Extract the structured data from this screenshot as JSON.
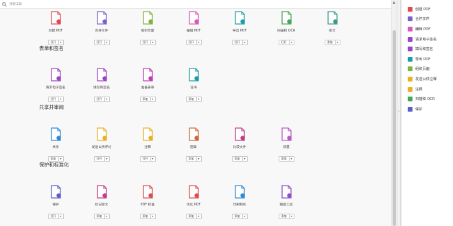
{
  "search": {
    "placeholder": "搜索工具"
  },
  "sections": [
    {
      "title": "",
      "tools": [
        {
          "name": "create-pdf",
          "label": "创建 PDF",
          "btn": "打开",
          "color": "#e34850"
        },
        {
          "name": "combine-files",
          "label": "合并文件",
          "btn": "打开",
          "color": "#7b61c7"
        },
        {
          "name": "organize-pages",
          "label": "组织页面",
          "btn": "打开",
          "color": "#7fb33b"
        },
        {
          "name": "edit-pdf",
          "label": "编辑 PDF",
          "btn": "打开",
          "color": "#d958b5"
        },
        {
          "name": "export-pdf",
          "label": "导出 PDF",
          "btn": "打开",
          "color": "#1b9fa3"
        },
        {
          "name": "scan-ocr",
          "label": "扫描和 OCR",
          "btn": "打开",
          "color": "#4aa35a"
        },
        {
          "name": "redact",
          "label": "密文",
          "btn": "添加",
          "color": "#3a9b8a"
        }
      ]
    },
    {
      "title": "表单和签名",
      "tools": [
        {
          "name": "request-signature",
          "label": "请求电子签名",
          "btn": "打开",
          "color": "#9c44c3"
        },
        {
          "name": "fill-sign",
          "label": "填写和签名",
          "btn": "打开",
          "color": "#9c44c3"
        },
        {
          "name": "prepare-form",
          "label": "准备表单",
          "btn": "添加",
          "color": "#c03dba"
        },
        {
          "name": "certificates",
          "label": "证书",
          "btn": "添加",
          "color": "#1b9fa3"
        }
      ]
    },
    {
      "title": "共享并审阅",
      "tools": [
        {
          "name": "share",
          "label": "共享",
          "btn": "添加",
          "color": "#2d89d6"
        },
        {
          "name": "send-for-comments",
          "label": "发送以供评论",
          "btn": "打开",
          "color": "#e8b023"
        },
        {
          "name": "comment",
          "label": "注释",
          "btn": "打开",
          "color": "#e8b023"
        },
        {
          "name": "stamp",
          "label": "图章",
          "btn": "添加",
          "color": "#c96b3b"
        },
        {
          "name": "compare-files",
          "label": "比较文件",
          "btn": "添加",
          "color": "#c03d85"
        },
        {
          "name": "measure",
          "label": "测量",
          "btn": "添加",
          "color": "#b65ac3"
        }
      ]
    },
    {
      "title": "保护和标准化",
      "tools": [
        {
          "name": "protect",
          "label": "保护",
          "btn": "打开",
          "color": "#5a5fc9"
        },
        {
          "name": "redact-sign",
          "label": "标记密文",
          "btn": "添加",
          "color": "#c23d85"
        },
        {
          "name": "pdf-standards",
          "label": "PDF 标准",
          "btn": "添加",
          "color": "#d94f4f"
        },
        {
          "name": "optimize-pdf",
          "label": "优化 PDF",
          "btn": "添加",
          "color": "#d94f4f"
        },
        {
          "name": "print-production",
          "label": "印刷制作",
          "btn": "添加",
          "color": "#2d89d6"
        },
        {
          "name": "accessibility",
          "label": "辅助工具",
          "btn": "添加",
          "color": "#8c4fc7"
        }
      ]
    }
  ],
  "right_panel": [
    {
      "label": "创建 PDF",
      "color": "#e34850"
    },
    {
      "label": "合并文件",
      "color": "#7b61c7"
    },
    {
      "label": "编辑 PDF",
      "color": "#d958b5"
    },
    {
      "label": "请求电子签名",
      "color": "#9c44c3"
    },
    {
      "label": "填写和签名",
      "color": "#9c44c3"
    },
    {
      "label": "导出 PDF",
      "color": "#1b9fa3"
    },
    {
      "label": "组织页面",
      "color": "#7fb33b"
    },
    {
      "label": "发送以供注释",
      "color": "#e8b023"
    },
    {
      "label": "注释",
      "color": "#e8b023"
    },
    {
      "label": "扫描和 OCR",
      "color": "#4aa35a"
    },
    {
      "label": "保护",
      "color": "#5a5fc9"
    }
  ]
}
